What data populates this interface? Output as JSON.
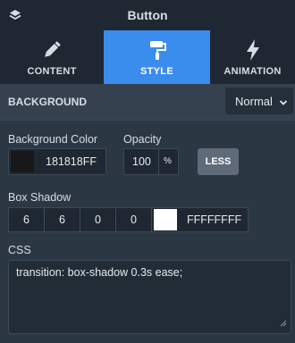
{
  "header": {
    "title": "Button",
    "icon": "layers-icon"
  },
  "tabs": [
    {
      "label": "CONTENT",
      "icon": "pencil-icon",
      "active": false
    },
    {
      "label": "STYLE",
      "icon": "paint-roller-icon",
      "active": true
    },
    {
      "label": "ANIMATION",
      "icon": "lightning-icon",
      "active": false
    }
  ],
  "background": {
    "section_label": "BACKGROUND",
    "state": "Normal"
  },
  "background_color": {
    "label": "Background Color",
    "hex": "181818FF",
    "swatch": "#181818"
  },
  "opacity": {
    "label": "Opacity",
    "value": "100",
    "unit": "%"
  },
  "less_button": "LESS",
  "box_shadow": {
    "label": "Box Shadow",
    "values": [
      "6",
      "6",
      "0",
      "0"
    ],
    "color_hex": "FFFFFFFF",
    "swatch": "#ffffff"
  },
  "css": {
    "label": "CSS",
    "code": "transition: box-shadow 0.3s ease;"
  },
  "colors": {
    "accent": "#3b8ded",
    "panel": "#2c3744",
    "header": "#1f2832"
  }
}
